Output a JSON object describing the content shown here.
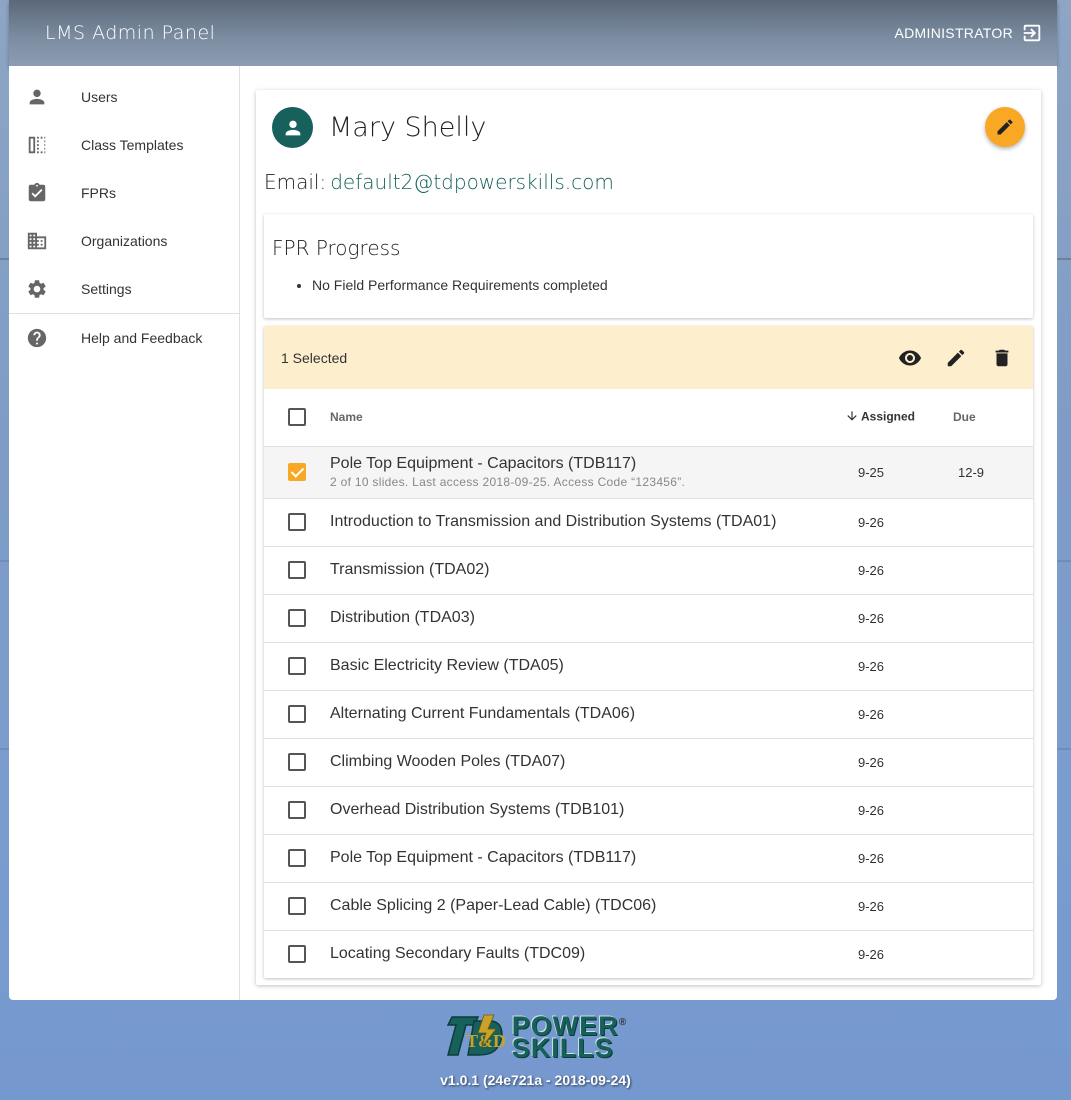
{
  "app": {
    "title": "LMS Admin Panel",
    "user_role": "ADMINISTRATOR"
  },
  "sidebar": {
    "items": [
      {
        "label": "Users",
        "icon": "person-icon"
      },
      {
        "label": "Class Templates",
        "icon": "template-icon"
      },
      {
        "label": "FPRs",
        "icon": "clipboard-check-icon"
      },
      {
        "label": "Organizations",
        "icon": "building-icon"
      },
      {
        "label": "Settings",
        "icon": "gear-icon"
      }
    ],
    "secondary": [
      {
        "label": "Help and Feedback",
        "icon": "help-icon"
      }
    ]
  },
  "user": {
    "name": "Mary Shelly",
    "email_label": "Email:",
    "email": "default2@tdpowerskills.com"
  },
  "fpr": {
    "title": "FPR Progress",
    "items": [
      "No Field Performance Requirements completed"
    ]
  },
  "table": {
    "selected_text": "1 Selected",
    "headers": {
      "name": "Name",
      "assigned": "Assigned",
      "due": "Due"
    },
    "rows": [
      {
        "name": "Pole Top Equipment - Capacitors (TDB117)",
        "sub": "2 of 10 slides. Last access 2018-09-25. Access Code “123456”.",
        "assigned": "9-25",
        "due": "12-9",
        "checked": true
      },
      {
        "name": "Introduction to Transmission and Distribution Systems (TDA01)",
        "assigned": "9-26",
        "due": ""
      },
      {
        "name": "Transmission (TDA02)",
        "assigned": "9-26",
        "due": ""
      },
      {
        "name": "Distribution (TDA03)",
        "assigned": "9-26",
        "due": ""
      },
      {
        "name": "Basic Electricity Review (TDA05)",
        "assigned": "9-26",
        "due": ""
      },
      {
        "name": "Alternating Current Fundamentals (TDA06)",
        "assigned": "9-26",
        "due": ""
      },
      {
        "name": "Climbing Wooden Poles (TDA07)",
        "assigned": "9-26",
        "due": ""
      },
      {
        "name": "Overhead Distribution Systems (TDB101)",
        "assigned": "9-26",
        "due": ""
      },
      {
        "name": "Pole Top Equipment - Capacitors (TDB117)",
        "assigned": "9-26",
        "due": ""
      },
      {
        "name": "Cable Splicing 2 (Paper-Lead Cable) (TDC06)",
        "assigned": "9-26",
        "due": ""
      },
      {
        "name": "Locating Secondary Faults (TDC09)",
        "assigned": "9-26",
        "due": ""
      }
    ]
  },
  "footer": {
    "logo_line1": "POWER",
    "logo_line2": "SKILLS",
    "logo_mark_text": "T&D",
    "registered": "®",
    "version": "v1.0.1 (24e721a - 2018-09-24)"
  },
  "colors": {
    "accent": "#f9a825",
    "brand": "#16615c",
    "selection": "#fdefce"
  }
}
